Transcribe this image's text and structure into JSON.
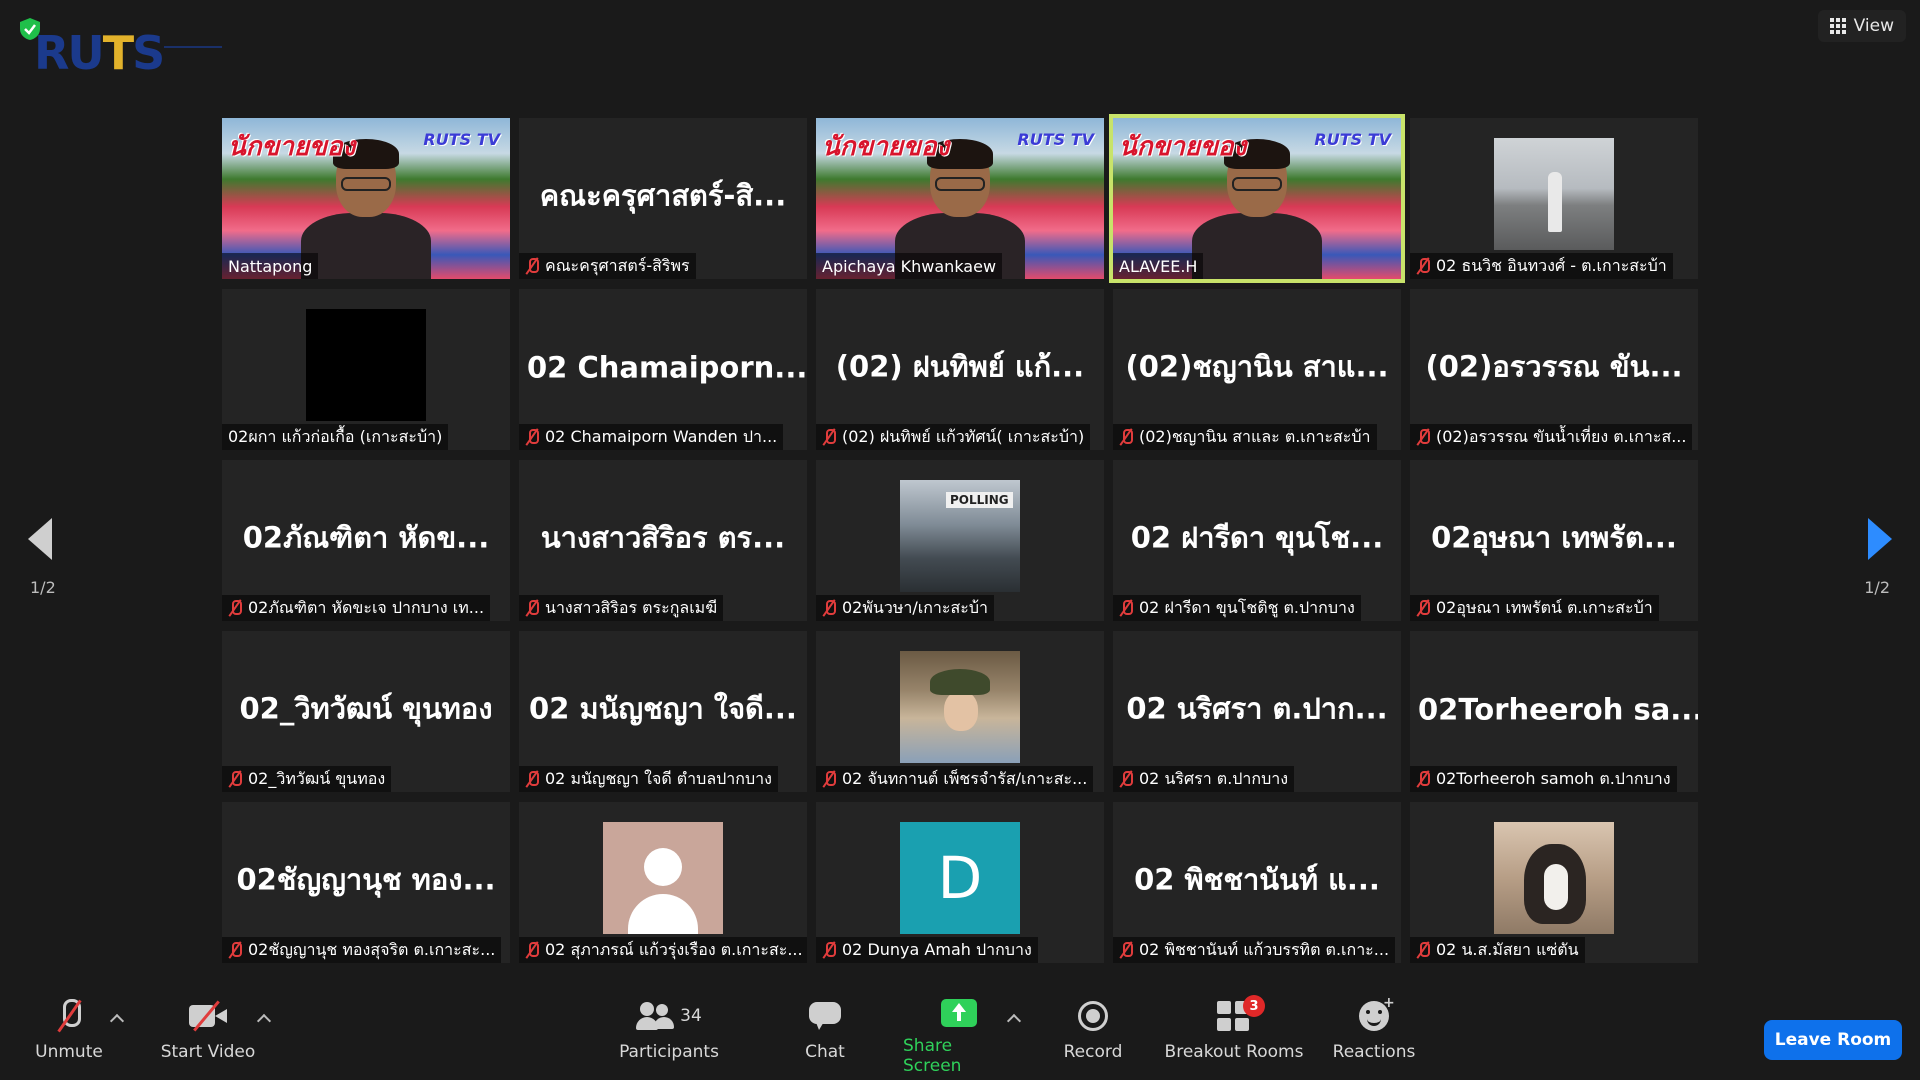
{
  "header": {
    "logo_parts": [
      "RU",
      "T",
      "S"
    ],
    "view_label": "View"
  },
  "pagination": {
    "left": "1/2",
    "right": "1/2"
  },
  "tiles": [
    {
      "label": "Nattapong",
      "muted": false,
      "kind": "video",
      "banner": "นักขายของ",
      "banner_tag": "RUTS TV",
      "active": false
    },
    {
      "label": "คณะครุศาสตร์-สิริพร",
      "muted": true,
      "kind": "name",
      "big": "คณะครุศาสตร์-สิ..."
    },
    {
      "label": "Apichaya Khwankaew",
      "muted": false,
      "kind": "video",
      "banner": "นักขายของ",
      "banner_tag": "RUTS TV",
      "active": false
    },
    {
      "label": "ALAVEE.H",
      "muted": false,
      "kind": "video",
      "banner": "นักขายของ",
      "banner_tag": "RUTS TV",
      "active": true
    },
    {
      "label": "02 ธนวิช อินทวงศ์ - ต.เกาะสะบ้า",
      "muted": true,
      "kind": "photo-road"
    },
    {
      "label": "02ผกา แก้วก่อเกื้อ (เกาะสะบ้า)",
      "muted": false,
      "kind": "photo-black"
    },
    {
      "label": "02 Chamaiporn Wanden ปา...",
      "muted": true,
      "kind": "name",
      "big": "02  Chamaiporn..."
    },
    {
      "label": "(02) ฝนทิพย์ แก้วทัศน์( เกาะสะบ้า)",
      "muted": true,
      "kind": "name",
      "big": "(02) ฝนทิพย์ แก้..."
    },
    {
      "label": "(02)ชญานิน สาและ ต.เกาะสะบ้า",
      "muted": true,
      "kind": "name",
      "big": "(02)ชญานิน สาแ..."
    },
    {
      "label": "(02)อรวรรณ ขันน้ำเที่ยง ต.เกาะส...",
      "muted": true,
      "kind": "name",
      "big": "(02)อรวรรณ ขัน..."
    },
    {
      "label": "02ภัณฑิตา  หัดขะเจ  ปากบาง เท...",
      "muted": true,
      "kind": "name",
      "big": "02ภัณฑิตา  หัดข..."
    },
    {
      "label": "นางสาวสิริอร  ตระกูลเมฆี",
      "muted": true,
      "kind": "name",
      "big": "นางสาวสิริอร  ตร..."
    },
    {
      "label": "02พันวษา/เกาะสะบ้า",
      "muted": true,
      "kind": "photo-poll",
      "sign": "POLLING"
    },
    {
      "label": "02 ฝารีดา ขุนโชติชู ต.ปากบาง",
      "muted": true,
      "kind": "name",
      "big": "02 ฝารีดา ขุนโช..."
    },
    {
      "label": "02อุษณา เทพรัตน์ ต.เกาะสะบ้า",
      "muted": true,
      "kind": "name",
      "big": "02อุษณา เทพรัต..."
    },
    {
      "label": "02_วิทวัฒน์ ขุนทอง",
      "muted": true,
      "kind": "name",
      "big": "02_วิทวัฒน์ ขุนทอง"
    },
    {
      "label": "02 มนัญชญา ใจดี ตำบลปากบาง",
      "muted": true,
      "kind": "name",
      "big": "02 มนัญชญา ใจดี..."
    },
    {
      "label": "02 จันทกานต์ เพ็ชรจำรัส/เกาะสะ...",
      "muted": true,
      "kind": "photo-girl"
    },
    {
      "label": "02 นริศรา ต.ปากบาง",
      "muted": true,
      "kind": "name",
      "big": "02 นริศรา ต.ปาก..."
    },
    {
      "label": "02Torheeroh samoh ต.ปากบาง",
      "muted": true,
      "kind": "name",
      "big": "02Torheeroh  sa..."
    },
    {
      "label": "02ชัญญานุช ทองสุจริต ต.เกาะสะ...",
      "muted": true,
      "kind": "name",
      "big": "02ชัญญานุช ทอง..."
    },
    {
      "label": "02 สุภาภรณ์ แก้วรุ่งเรือง ต.เกาะสะ...",
      "muted": true,
      "kind": "avatar-gray"
    },
    {
      "label": "02 Dunya Amah ปากบาง",
      "muted": true,
      "kind": "avatar-letter",
      "letter": "D"
    },
    {
      "label": "02 พิชชานันท์ แก้วบรรทิต ต.เกาะ...",
      "muted": true,
      "kind": "name",
      "big": "02 พิชชานันท์ แ..."
    },
    {
      "label": "02 น.ส.มัสยา แซ่ตัน",
      "muted": true,
      "kind": "photo-cat"
    }
  ],
  "toolbar": {
    "unmute": "Unmute",
    "start_video": "Start Video",
    "participants": "Participants",
    "participants_count": "34",
    "chat": "Chat",
    "share_screen": "Share Screen",
    "record": "Record",
    "breakout_rooms": "Breakout Rooms",
    "breakout_badge": "3",
    "reactions": "Reactions",
    "leave": "Leave Room"
  },
  "colors": {
    "active_border": "#c8e36a",
    "share_green": "#2fd15a",
    "leave_blue": "#0e71eb",
    "muted_red": "#e03c3c"
  }
}
